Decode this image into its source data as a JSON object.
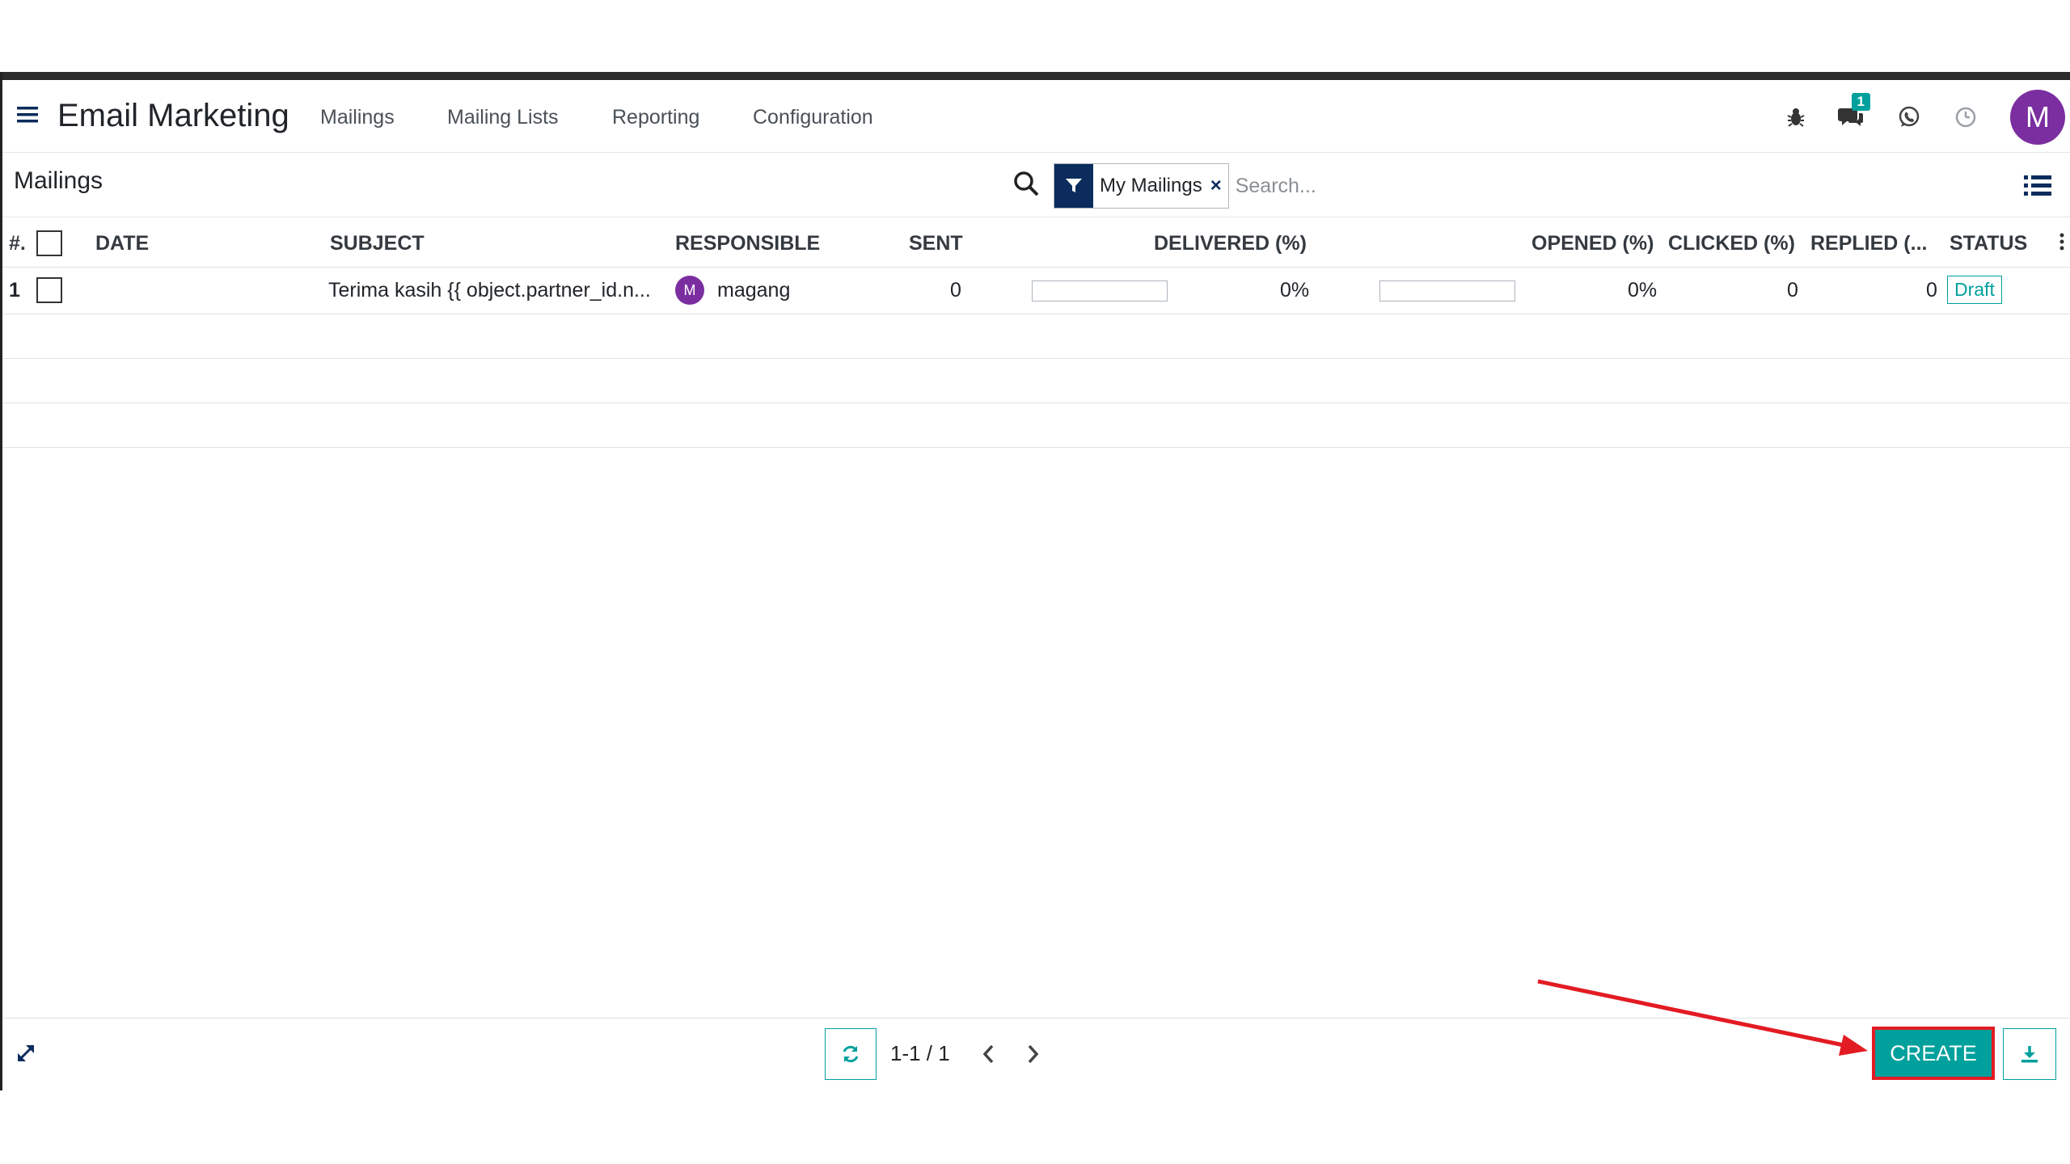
{
  "navbar": {
    "app_title": "Email Marketing",
    "menu": [
      "Mailings",
      "Mailing Lists",
      "Reporting",
      "Configuration"
    ],
    "chat_badge": "1",
    "avatar_letter": "M",
    "icons": [
      "bug-icon",
      "chat-icon",
      "whatsapp-icon",
      "clock-icon"
    ]
  },
  "control_panel": {
    "breadcrumb": "Mailings",
    "facet_label": "My Mailings",
    "facet_remove": "×",
    "search_placeholder": "Search..."
  },
  "table": {
    "headers": {
      "num": "#.",
      "date": "DATE",
      "subject": "SUBJECT",
      "responsible": "RESPONSIBLE",
      "sent": "SENT",
      "delivered": "DELIVERED (%)",
      "opened": "OPENED (%)",
      "clicked": "CLICKED (%)",
      "replied": "REPLIED (...",
      "status": "STATUS"
    },
    "rows": [
      {
        "num": "1",
        "date": "",
        "subject": "Terima kasih {{ object.partner_id.n...",
        "responsible_initial": "M",
        "responsible": "magang",
        "sent": "0",
        "delivered_progress": 0,
        "delivered": "0%",
        "opened_progress": 0,
        "opened": "0%",
        "clicked": "0",
        "replied": "0",
        "status": "Draft"
      }
    ]
  },
  "footer": {
    "pager": "1-1 / 1",
    "create_label": "CREATE"
  },
  "colors": {
    "primary": "#00a09d",
    "facet_dark": "#0b2c5c",
    "avatar": "#7b2ea0",
    "annotation_red": "#e31b23"
  }
}
